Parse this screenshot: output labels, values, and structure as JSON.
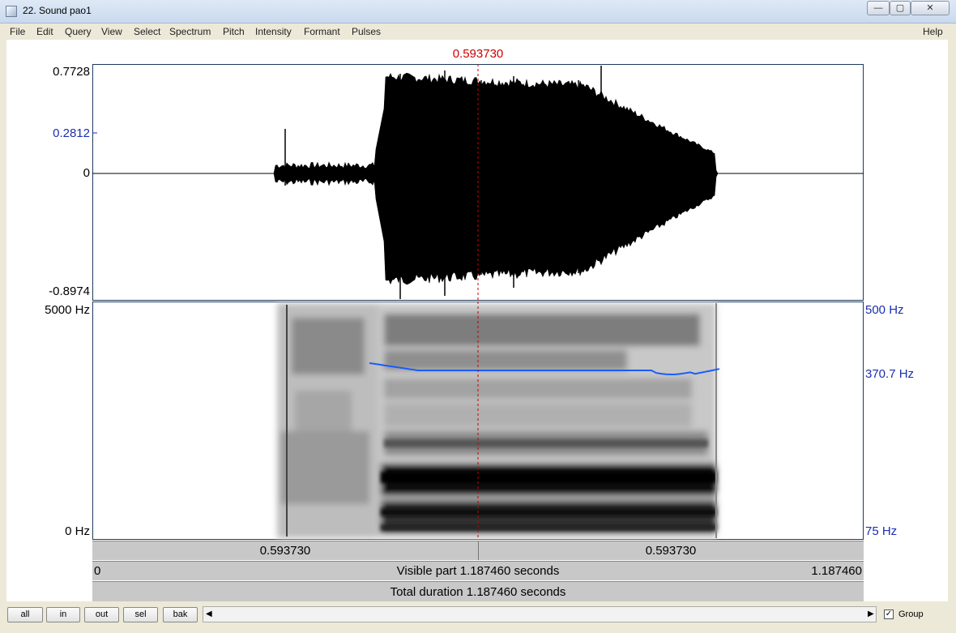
{
  "window": {
    "title": "22. Sound pao1",
    "minimize": "—",
    "restore": "▢",
    "close": "✕"
  },
  "menu": {
    "items": [
      "File",
      "Edit",
      "Query",
      "View",
      "Select",
      "Spectrum",
      "Pitch",
      "Intensity",
      "Formant",
      "Pulses"
    ],
    "help": "Help"
  },
  "cursor": {
    "time_label": "0.593730"
  },
  "waveform": {
    "ymax": "0.7728",
    "ycursor": "0.2812",
    "yzero": "0",
    "ymin": "-0.8974"
  },
  "spectrogram": {
    "freq_max": "5000 Hz",
    "freq_min": "0 Hz",
    "pitch_max": "500 Hz",
    "pitch_value": "370.7 Hz",
    "pitch_min": "75 Hz"
  },
  "timebars": {
    "left_part": "0.593730",
    "right_part": "0.593730",
    "visible_start": "0",
    "visible_label": "Visible part 1.187460 seconds",
    "visible_end": "1.187460",
    "total_label": "Total duration 1.187460 seconds"
  },
  "controls": {
    "all": "all",
    "in": "in",
    "out": "out",
    "sel": "sel",
    "bak": "bak",
    "scroll_left": "◀",
    "scroll_right": "▶",
    "group_check": "✓",
    "group": "Group"
  },
  "colors": {
    "cursor": "#cc0000",
    "pitch": "#1a5cff",
    "axis_blue": "#1a2fb0"
  }
}
